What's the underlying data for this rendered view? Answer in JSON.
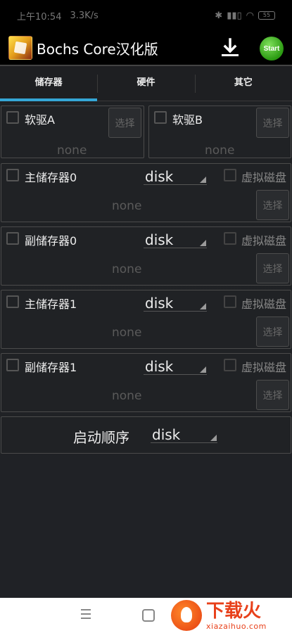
{
  "status": {
    "time": "上午10:54",
    "speed": "3.3K/s",
    "battery": "55"
  },
  "app": {
    "title": "Bochs Core汉化版",
    "start_label": "Start"
  },
  "tabs": [
    {
      "label": "储存器",
      "active": true
    },
    {
      "label": "硬件"
    },
    {
      "label": "其它"
    }
  ],
  "floppies": [
    {
      "label": "软驱A",
      "value": "none",
      "pick": "选择"
    },
    {
      "label": "软驱B",
      "value": "none",
      "pick": "选择"
    }
  ],
  "drives": [
    {
      "label": "主储存器0",
      "type": "disk",
      "virtual_label": "虚拟磁盘",
      "value": "none",
      "pick": "选择"
    },
    {
      "label": "副储存器0",
      "type": "disk",
      "virtual_label": "虚拟磁盘",
      "value": "none",
      "pick": "选择"
    },
    {
      "label": "主储存器1",
      "type": "disk",
      "virtual_label": "虚拟磁盘",
      "value": "none",
      "pick": "选择"
    },
    {
      "label": "副储存器1",
      "type": "disk",
      "virtual_label": "虚拟磁盘",
      "value": "none",
      "pick": "选择"
    }
  ],
  "boot": {
    "label": "启动顺序",
    "value": "disk"
  },
  "watermark": {
    "cn": "下载火",
    "en": "xiazaihuo.com"
  },
  "colors": {
    "accent": "#35a6d6",
    "background": "#202225",
    "start_green": "#2b9a12"
  }
}
